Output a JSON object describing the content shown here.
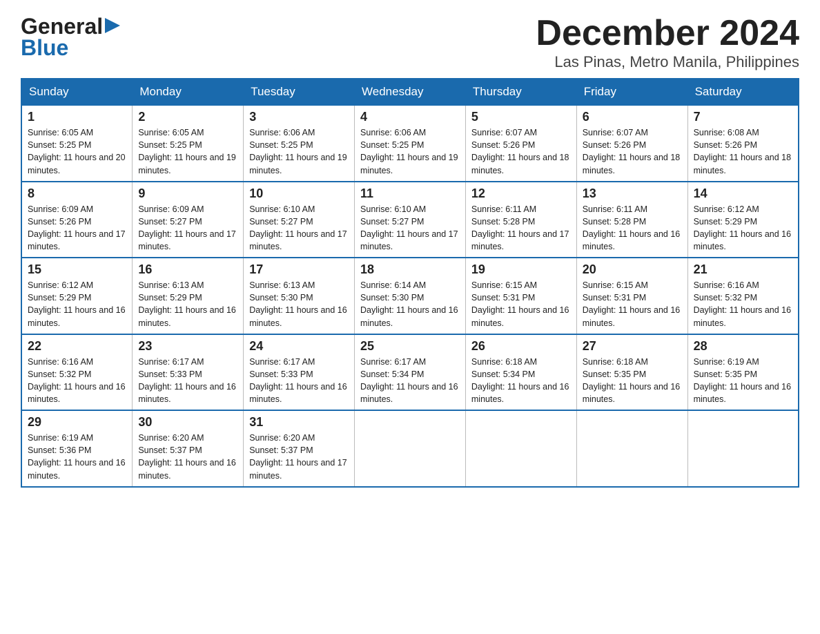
{
  "header": {
    "logo_general": "General",
    "logo_blue": "Blue",
    "main_title": "December 2024",
    "subtitle": "Las Pinas, Metro Manila, Philippines"
  },
  "calendar": {
    "days_of_week": [
      "Sunday",
      "Monday",
      "Tuesday",
      "Wednesday",
      "Thursday",
      "Friday",
      "Saturday"
    ],
    "weeks": [
      [
        {
          "date": "1",
          "sunrise": "6:05 AM",
          "sunset": "5:25 PM",
          "daylight": "11 hours and 20 minutes."
        },
        {
          "date": "2",
          "sunrise": "6:05 AM",
          "sunset": "5:25 PM",
          "daylight": "11 hours and 19 minutes."
        },
        {
          "date": "3",
          "sunrise": "6:06 AM",
          "sunset": "5:25 PM",
          "daylight": "11 hours and 19 minutes."
        },
        {
          "date": "4",
          "sunrise": "6:06 AM",
          "sunset": "5:25 PM",
          "daylight": "11 hours and 19 minutes."
        },
        {
          "date": "5",
          "sunrise": "6:07 AM",
          "sunset": "5:26 PM",
          "daylight": "11 hours and 18 minutes."
        },
        {
          "date": "6",
          "sunrise": "6:07 AM",
          "sunset": "5:26 PM",
          "daylight": "11 hours and 18 minutes."
        },
        {
          "date": "7",
          "sunrise": "6:08 AM",
          "sunset": "5:26 PM",
          "daylight": "11 hours and 18 minutes."
        }
      ],
      [
        {
          "date": "8",
          "sunrise": "6:09 AM",
          "sunset": "5:26 PM",
          "daylight": "11 hours and 17 minutes."
        },
        {
          "date": "9",
          "sunrise": "6:09 AM",
          "sunset": "5:27 PM",
          "daylight": "11 hours and 17 minutes."
        },
        {
          "date": "10",
          "sunrise": "6:10 AM",
          "sunset": "5:27 PM",
          "daylight": "11 hours and 17 minutes."
        },
        {
          "date": "11",
          "sunrise": "6:10 AM",
          "sunset": "5:27 PM",
          "daylight": "11 hours and 17 minutes."
        },
        {
          "date": "12",
          "sunrise": "6:11 AM",
          "sunset": "5:28 PM",
          "daylight": "11 hours and 17 minutes."
        },
        {
          "date": "13",
          "sunrise": "6:11 AM",
          "sunset": "5:28 PM",
          "daylight": "11 hours and 16 minutes."
        },
        {
          "date": "14",
          "sunrise": "6:12 AM",
          "sunset": "5:29 PM",
          "daylight": "11 hours and 16 minutes."
        }
      ],
      [
        {
          "date": "15",
          "sunrise": "6:12 AM",
          "sunset": "5:29 PM",
          "daylight": "11 hours and 16 minutes."
        },
        {
          "date": "16",
          "sunrise": "6:13 AM",
          "sunset": "5:29 PM",
          "daylight": "11 hours and 16 minutes."
        },
        {
          "date": "17",
          "sunrise": "6:13 AM",
          "sunset": "5:30 PM",
          "daylight": "11 hours and 16 minutes."
        },
        {
          "date": "18",
          "sunrise": "6:14 AM",
          "sunset": "5:30 PM",
          "daylight": "11 hours and 16 minutes."
        },
        {
          "date": "19",
          "sunrise": "6:15 AM",
          "sunset": "5:31 PM",
          "daylight": "11 hours and 16 minutes."
        },
        {
          "date": "20",
          "sunrise": "6:15 AM",
          "sunset": "5:31 PM",
          "daylight": "11 hours and 16 minutes."
        },
        {
          "date": "21",
          "sunrise": "6:16 AM",
          "sunset": "5:32 PM",
          "daylight": "11 hours and 16 minutes."
        }
      ],
      [
        {
          "date": "22",
          "sunrise": "6:16 AM",
          "sunset": "5:32 PM",
          "daylight": "11 hours and 16 minutes."
        },
        {
          "date": "23",
          "sunrise": "6:17 AM",
          "sunset": "5:33 PM",
          "daylight": "11 hours and 16 minutes."
        },
        {
          "date": "24",
          "sunrise": "6:17 AM",
          "sunset": "5:33 PM",
          "daylight": "11 hours and 16 minutes."
        },
        {
          "date": "25",
          "sunrise": "6:17 AM",
          "sunset": "5:34 PM",
          "daylight": "11 hours and 16 minutes."
        },
        {
          "date": "26",
          "sunrise": "6:18 AM",
          "sunset": "5:34 PM",
          "daylight": "11 hours and 16 minutes."
        },
        {
          "date": "27",
          "sunrise": "6:18 AM",
          "sunset": "5:35 PM",
          "daylight": "11 hours and 16 minutes."
        },
        {
          "date": "28",
          "sunrise": "6:19 AM",
          "sunset": "5:35 PM",
          "daylight": "11 hours and 16 minutes."
        }
      ],
      [
        {
          "date": "29",
          "sunrise": "6:19 AM",
          "sunset": "5:36 PM",
          "daylight": "11 hours and 16 minutes."
        },
        {
          "date": "30",
          "sunrise": "6:20 AM",
          "sunset": "5:37 PM",
          "daylight": "11 hours and 16 minutes."
        },
        {
          "date": "31",
          "sunrise": "6:20 AM",
          "sunset": "5:37 PM",
          "daylight": "11 hours and 17 minutes."
        },
        null,
        null,
        null,
        null
      ]
    ]
  }
}
